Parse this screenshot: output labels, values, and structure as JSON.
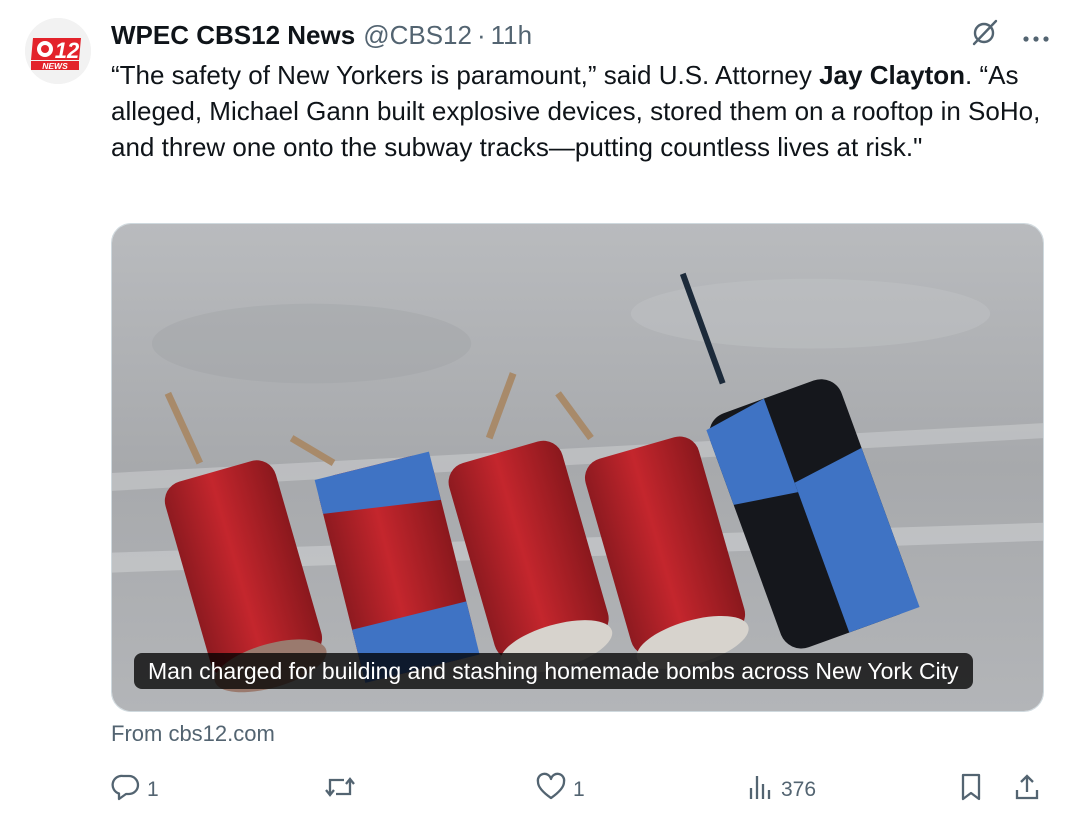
{
  "tweet": {
    "author": {
      "display_name": "WPEC CBS12 News",
      "handle": "@CBS12",
      "separator": "·",
      "time": "11h"
    },
    "avatar_text": {
      "number": "12",
      "news": "NEWS"
    },
    "text": {
      "part1": "“The safety of New Yorkers is paramount,” said U.S. Attorney ",
      "bold_name": "Jay Clayton",
      "part2": ". “As alleged, Michael Gann built explosive devices, stored them on a rooftop in SoHo, and threw one onto the subway tracks—putting countless lives at risk.\""
    },
    "card": {
      "caption": "Man charged for building and stashing homemade bombs across New York City",
      "source": "From cbs12.com"
    },
    "actions": {
      "reply_count": "1",
      "like_count": "1",
      "views_count": "376"
    }
  },
  "colors": {
    "text": "#0f1419",
    "muted": "#536471",
    "brand_red": "#e3232b"
  }
}
